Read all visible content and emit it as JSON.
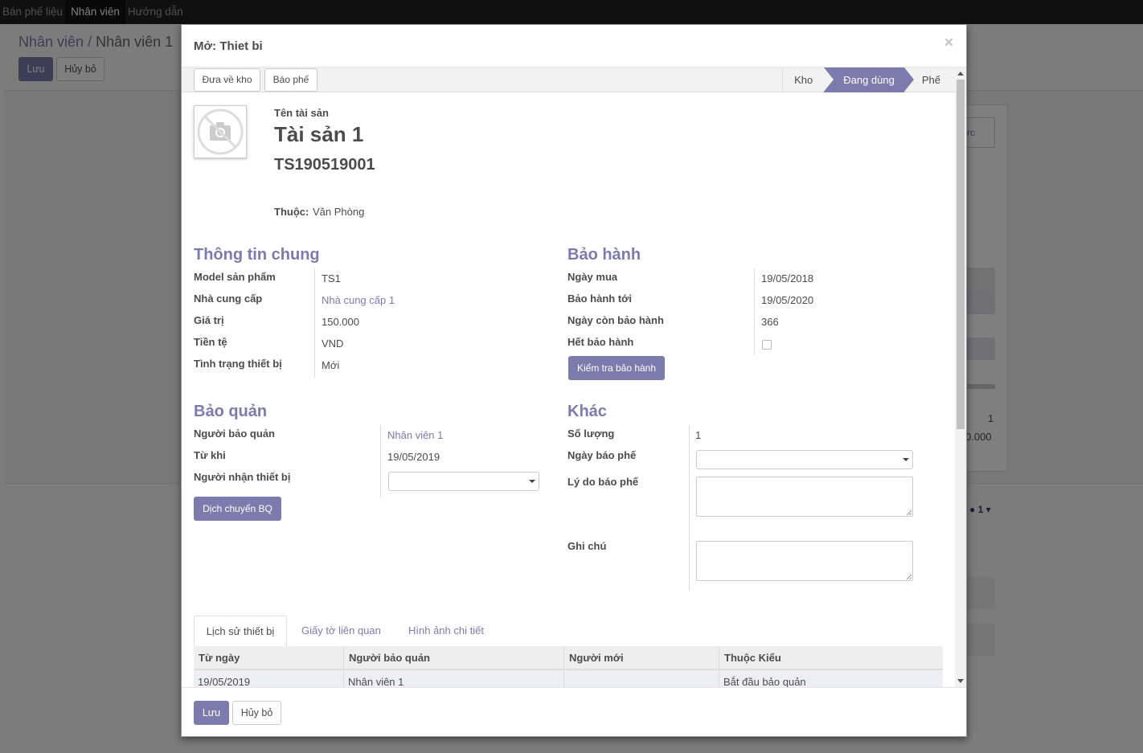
{
  "topbar": {
    "menu": [
      "Bán phế liệu",
      "Nhân viên",
      "Hướng dẫn"
    ]
  },
  "background": {
    "breadcrumb": {
      "parent": "Nhân viên",
      "separator": "/",
      "current": "Nhân viên 1"
    },
    "save_label": "Lưu",
    "discard_label": "Hủy bỏ",
    "stat_text": "rc",
    "num1": "1",
    "num2": "0.000",
    "followers": "1"
  },
  "modal": {
    "title": "Mở: Thiet bi",
    "close": "×",
    "statusbar": {
      "buttons": [
        "Đưa về kho",
        "Báo phế"
      ],
      "stages": [
        "Kho",
        "Đang dùng",
        "Phế"
      ],
      "active_stage": "Đang dùng"
    },
    "header": {
      "name_label": "Tên tài sản",
      "name": "Tài sản 1",
      "code": "TS190519001",
      "belongs_label": "Thuộc:",
      "belongs_value": "Văn Phòng"
    },
    "general": {
      "title": "Thông tin chung",
      "fields": [
        {
          "label": "Model sản phẩm",
          "value": "TS1"
        },
        {
          "label": "Nhà cung cấp",
          "value": "Nhà cung cấp 1"
        },
        {
          "label": "Giá trị",
          "value": "150.000"
        },
        {
          "label": "Tiền tệ",
          "value": "VND"
        },
        {
          "label": "Tình trạng thiết bị",
          "value": "Mới"
        }
      ]
    },
    "warranty": {
      "title": "Bảo hành",
      "fields": [
        {
          "label": "Ngày mua",
          "value": "19/05/2018"
        },
        {
          "label": "Bảo hành tới",
          "value": "19/05/2020"
        },
        {
          "label": "Ngày còn bảo hành",
          "value": "366"
        },
        {
          "label": "Hết bảo hành",
          "value": ""
        }
      ],
      "check_button": "Kiểm tra bảo hành"
    },
    "custody": {
      "title": "Bảo quản",
      "fields": [
        {
          "label": "Người bảo quản",
          "value": "Nhân viên 1"
        },
        {
          "label": "Từ khi",
          "value": "19/05/2019"
        },
        {
          "label": "Người nhận thiết bị",
          "value": ""
        }
      ],
      "move_button": "Dịch chuyển BQ"
    },
    "other": {
      "title": "Khác",
      "fields": [
        {
          "label": "Số lượng",
          "value": "1"
        },
        {
          "label": "Ngày báo phế",
          "value": ""
        },
        {
          "label": "Lý do báo phế",
          "value": ""
        },
        {
          "label": "Ghi chú",
          "value": ""
        }
      ]
    },
    "tabs": [
      "Lịch sử thiết bị",
      "Giấy tờ liên quan",
      "Hình ảnh chi tiết"
    ],
    "history_table": {
      "columns": [
        "Từ ngày",
        "Người bảo quản",
        "Người mới",
        "Thuộc Kiểu"
      ],
      "rows": [
        [
          "19/05/2019",
          "Nhân viên 1",
          "",
          "Bắt đầu bảo quản"
        ]
      ]
    },
    "footer": {
      "save_label": "Lưu",
      "discard_label": "Hủy bỏ"
    }
  },
  "colors": {
    "brand": "#7c7bad",
    "topbar": "#212121"
  }
}
